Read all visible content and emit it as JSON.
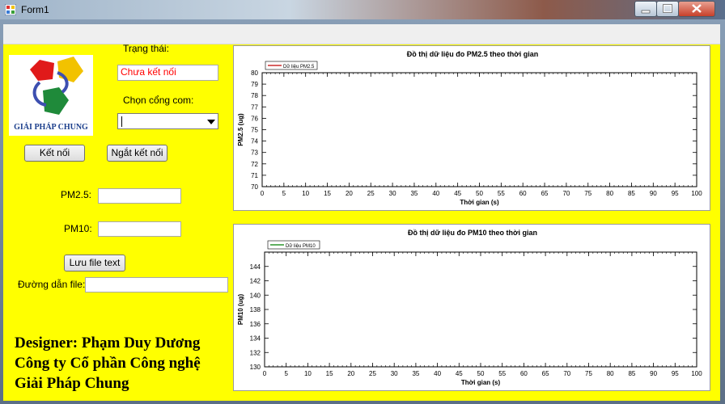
{
  "window": {
    "title": "Form1"
  },
  "status": {
    "label": "Trạng thái:",
    "value": "Chưa kết nối",
    "value_color": "#ff0000"
  },
  "port": {
    "label": "Chọn cổng com:",
    "selected": ""
  },
  "buttons": {
    "connect": "Kết nối",
    "disconnect": "Ngắt kết nối",
    "save": "Lưu file text"
  },
  "readings": {
    "pm25_label": "PM2.5:",
    "pm25_value": "",
    "pm10_label": "PM10:",
    "pm10_value": ""
  },
  "file": {
    "label": "Đường dẫn file:",
    "path": ""
  },
  "logo": {
    "text": "GIẢI PHÁP CHUNG"
  },
  "credits": {
    "line1": "Designer: Phạm Duy Dương",
    "line2": "Công ty Cổ phần Công nghệ",
    "line3": "Giải Pháp Chung"
  },
  "chart_data": [
    {
      "type": "line",
      "title": "Đồ thị dữ liệu đo PM2.5 theo thời gian",
      "xlabel": "Thời gian (s)",
      "ylabel": "PM2.5 (ug)",
      "xlim": [
        0,
        100
      ],
      "ylim": [
        70,
        80
      ],
      "xticks": [
        0,
        5,
        10,
        15,
        20,
        25,
        30,
        35,
        40,
        45,
        50,
        55,
        60,
        65,
        70,
        75,
        80,
        85,
        90,
        95,
        100
      ],
      "yticks": [
        70,
        71,
        72,
        73,
        74,
        75,
        76,
        77,
        78,
        79,
        80
      ],
      "legend_placement": "top-left",
      "series": [
        {
          "name": "Dữ liệu PM2.5",
          "color": "#c00000",
          "x": [],
          "y": []
        }
      ]
    },
    {
      "type": "line",
      "title": "Đồ thị dữ liệu đo PM10 theo thời gian",
      "xlabel": "Thời gian (s)",
      "ylabel": "PM10 (ug)",
      "xlim": [
        0,
        100
      ],
      "ylim": [
        130,
        146
      ],
      "xticks": [
        0,
        5,
        10,
        15,
        20,
        25,
        30,
        35,
        40,
        45,
        50,
        55,
        60,
        65,
        70,
        75,
        80,
        85,
        90,
        95,
        100
      ],
      "yticks": [
        130,
        132,
        134,
        136,
        138,
        140,
        142,
        144
      ],
      "legend_placement": "top-left",
      "series": [
        {
          "name": "Dữ liệu PM10",
          "color": "#008000",
          "x": [],
          "y": []
        }
      ]
    }
  ]
}
